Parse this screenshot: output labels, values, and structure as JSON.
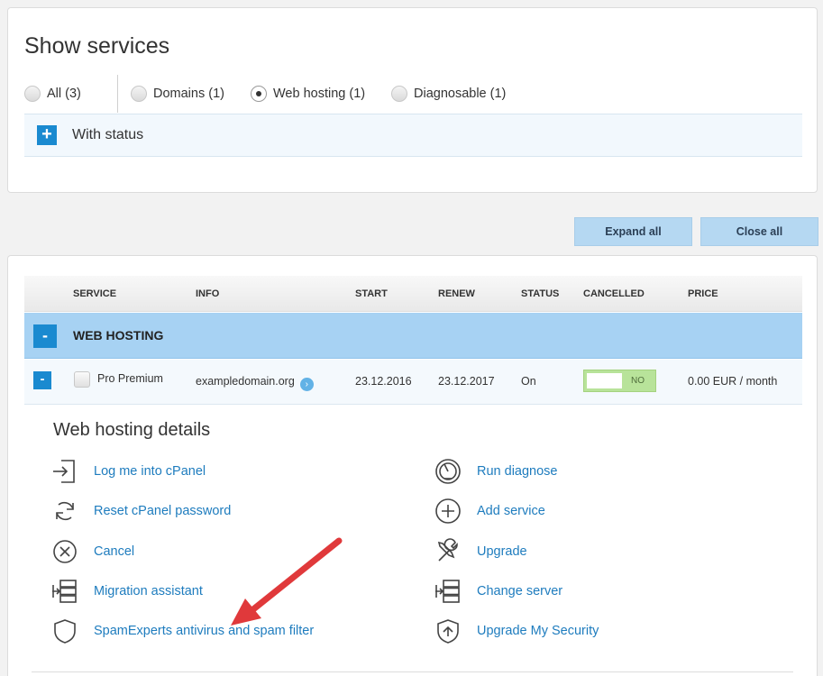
{
  "filter": {
    "title": "Show services",
    "options": [
      {
        "label": "All (3)",
        "checked": false
      },
      {
        "label": "Domains (1)",
        "checked": false
      },
      {
        "label": "Web hosting (1)",
        "checked": true
      },
      {
        "label": "Diagnosable (1)",
        "checked": false
      }
    ],
    "status_label": "With status",
    "status_toggle_symbol": "+"
  },
  "toolbar": {
    "expand_all": "Expand all",
    "close_all": "Close all"
  },
  "table": {
    "headers": [
      "SERVICE",
      "INFO",
      "START",
      "RENEW",
      "STATUS",
      "CANCELLED",
      "PRICE"
    ],
    "group": {
      "toggle_symbol": "-",
      "title": "WEB HOSTING"
    },
    "rows": [
      {
        "toggle_symbol": "-",
        "service": "Pro Premium",
        "info": "exampledomain.org",
        "info_arrow": "›",
        "start": "23.12.2016",
        "renew": "23.12.2017",
        "status": "On",
        "cancelled": "NO",
        "price": "0.00 EUR / month"
      }
    ]
  },
  "details": {
    "title": "Web hosting details",
    "left_actions": [
      {
        "label": "Log me into cPanel",
        "icon": "login-icon"
      },
      {
        "label": "Reset cPanel password",
        "icon": "refresh-icon"
      },
      {
        "label": "Cancel",
        "icon": "cancel-circle-icon"
      },
      {
        "label": "Migration assistant",
        "icon": "server-migrate-icon"
      },
      {
        "label": "SpamExperts antivirus and spam filter",
        "icon": "shield-icon"
      }
    ],
    "right_actions": [
      {
        "label": "Run diagnose",
        "icon": "gauge-icon"
      },
      {
        "label": "Add service",
        "icon": "plus-circle-icon"
      },
      {
        "label": "Upgrade",
        "icon": "tools-icon"
      },
      {
        "label": "Change server",
        "icon": "server-change-icon"
      },
      {
        "label": "Upgrade My Security",
        "icon": "shield-upgrade-icon"
      }
    ]
  },
  "colors": {
    "accent": "#1a8ad0",
    "group_row": "#a7d2f3",
    "link": "#1e7cbe",
    "toggle_no": "#b8e39a",
    "annotation_arrow": "#e0393b"
  }
}
